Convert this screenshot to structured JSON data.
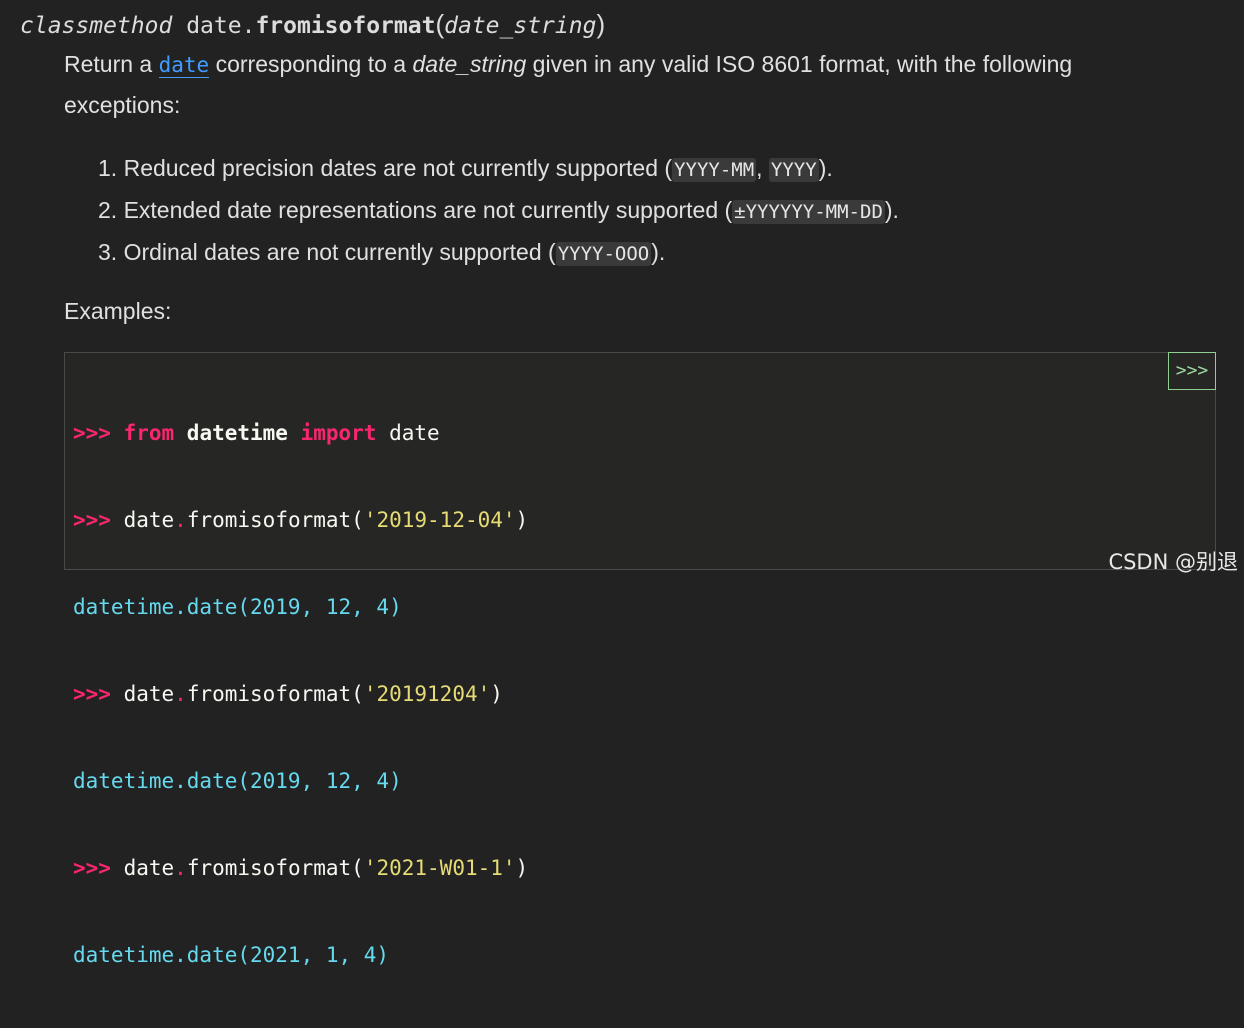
{
  "signature": {
    "keyword": "classmethod",
    "owner": "date.",
    "name": "fromisoformat",
    "open_paren": "(",
    "param": "date_string",
    "close_paren": ")"
  },
  "intro": {
    "text_before_link": "Return a ",
    "link": "date",
    "text_after_link": " corresponding to a ",
    "param": "date_string",
    "text_end": " given in any valid ISO 8601 format, with the following exceptions:"
  },
  "exceptions": [
    {
      "number": "1.",
      "text": " Reduced precision dates are not currently supported (",
      "code": [
        "YYYY-MM",
        "YYYY"
      ],
      "separator": ", ",
      "end": ")."
    },
    {
      "number": "2.",
      "text": " Extended date representations are not currently supported (",
      "code": [
        "±YYYYYY-MM-DD"
      ],
      "separator": "",
      "end": ")."
    },
    {
      "number": "3.",
      "text": " Ordinal dates are not currently supported (",
      "code": [
        "YYYY-OOO"
      ],
      "separator": "",
      "end": ")."
    }
  ],
  "examples_label": "Examples:",
  "code": {
    "toggle_label": ">>>",
    "prompt": ">>> ",
    "line1": {
      "kw_from": "from",
      "module": " datetime ",
      "kw_import": "import",
      "name": " date"
    },
    "line2": {
      "obj": "date",
      "dot": ".",
      "call": "fromisoformat(",
      "arg": "'2019-12-04'",
      "close": ")"
    },
    "line3": "datetime.date(2019, 12, 4)",
    "line4": {
      "obj": "date",
      "dot": ".",
      "call": "fromisoformat(",
      "arg": "'20191204'",
      "close": ")"
    },
    "line5": "datetime.date(2019, 12, 4)",
    "line6": {
      "obj": "date",
      "dot": ".",
      "call": "fromisoformat(",
      "arg": "'2021-W01-1'",
      "close": ")"
    },
    "line7": "datetime.date(2021, 1, 4)"
  },
  "watermark": "CSDN @别退"
}
